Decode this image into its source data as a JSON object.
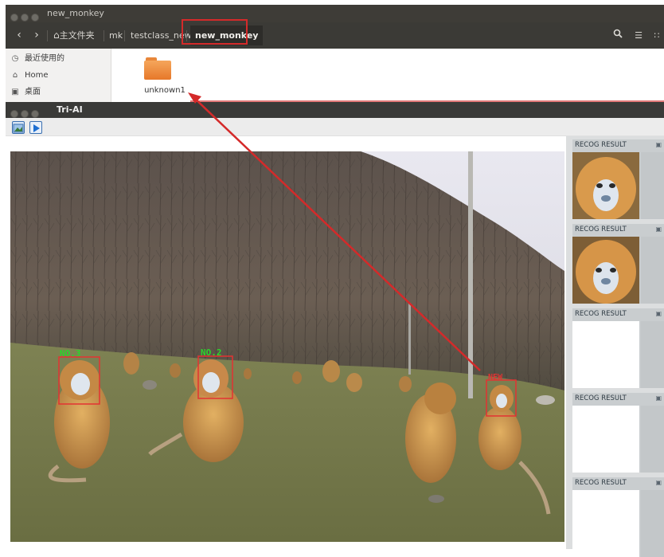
{
  "file_manager": {
    "window_title": "new_monkey",
    "breadcrumbs": [
      {
        "label": "主文件夹",
        "icon": "home-icon"
      },
      {
        "label": "mk"
      },
      {
        "label": "testclass_new"
      },
      {
        "label": "new_monkey"
      }
    ],
    "sidebar": [
      {
        "label": "最近使用的",
        "icon": "clock-icon"
      },
      {
        "label": "Home",
        "icon": "home-icon"
      },
      {
        "label": "桌面",
        "icon": "folder-icon"
      }
    ],
    "folder": {
      "name": "unknown1",
      "color": "#e8873a"
    }
  },
  "app": {
    "window_title": "Tri-AI",
    "toolbar": [
      {
        "icon": "image-open-icon"
      },
      {
        "icon": "play-icon"
      }
    ]
  },
  "detections": [
    {
      "label": "NO.3",
      "color": "#2bd52b"
    },
    {
      "label": "NO.2",
      "color": "#2bd52b"
    },
    {
      "label": "NEW",
      "color": "#e33232"
    }
  ],
  "recog_results": [
    {
      "label": "RECOG RESULT",
      "has_image": true
    },
    {
      "label": "RECOG RESULT",
      "has_image": true
    },
    {
      "label": "RECOG RESULT",
      "has_image": false
    },
    {
      "label": "RECOG RESULT",
      "has_image": false
    },
    {
      "label": "RECOG RESULT",
      "has_image": false
    }
  ],
  "colors": {
    "highlight": "#d42a2a",
    "titlebar": "#3e3c37",
    "accent_orange": "#e8873a"
  }
}
